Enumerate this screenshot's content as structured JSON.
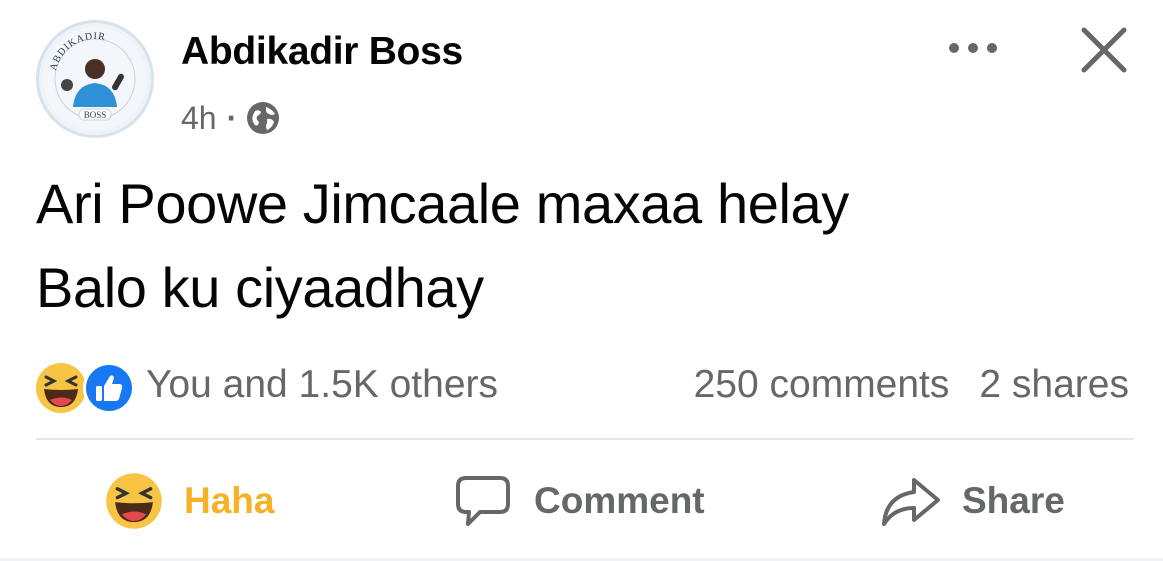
{
  "post": {
    "author": "Abdikadir Boss",
    "time": "4h",
    "separator": "·",
    "audience_icon": "globe-icon",
    "avatar_text_top": "ABDIKADIR",
    "avatar_text_bottom": "BOSS",
    "text_lines": [
      "Ari Poowe Jimcaale maxaa helay",
      "Balo ku ciyaadhay"
    ]
  },
  "header_actions": {
    "more_icon": "more-horizontal-icon",
    "close_icon": "close-icon"
  },
  "reactions": {
    "icons": [
      "haha-icon",
      "like-icon"
    ],
    "summary": "You and 1.5K others"
  },
  "engagement": {
    "comments": "250 comments",
    "shares": "2 shares"
  },
  "actions": {
    "reaction_label": "Haha",
    "comment_label": "Comment",
    "share_label": "Share"
  },
  "colors": {
    "haha_accent": "#f7b125",
    "like_blue": "#1877f2",
    "secondary_text": "#65676b",
    "divider": "#e4e6eb"
  }
}
